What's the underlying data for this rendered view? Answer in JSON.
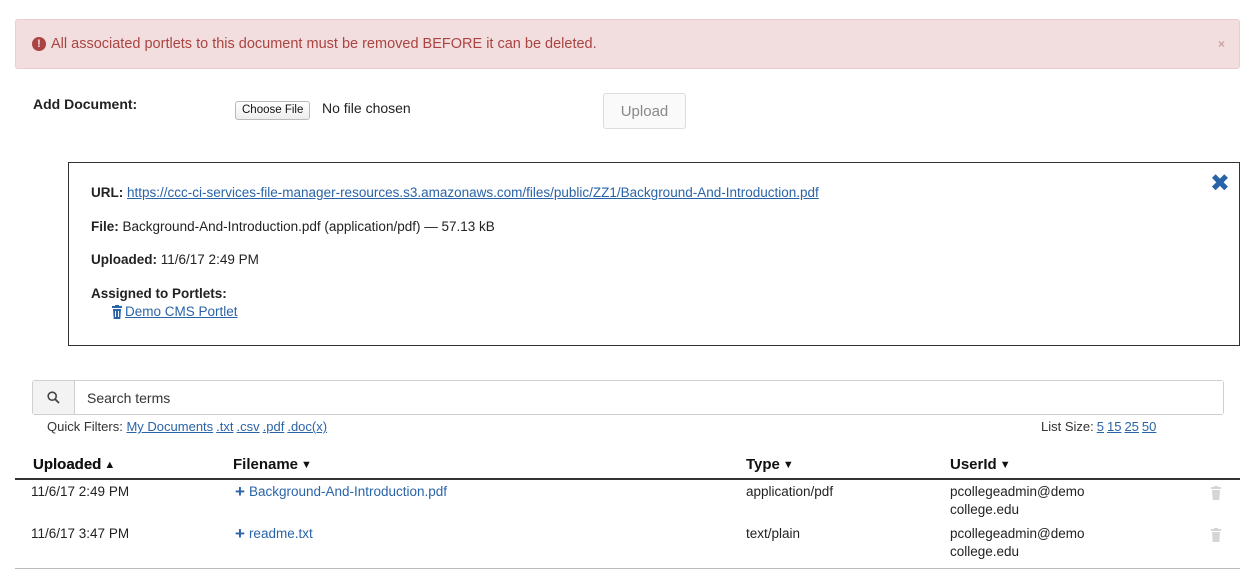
{
  "alert": {
    "message": "All associated portlets to this document must be removed BEFORE it can be deleted.",
    "close": "×"
  },
  "upload": {
    "label": "Add Document:",
    "choose_button": "Choose File",
    "no_file": "No file chosen",
    "upload_button": "Upload"
  },
  "detail": {
    "url_label": "URL:",
    "url": "https://ccc-ci-services-file-manager-resources.s3.amazonaws.com/files/public/ZZ1/Background-And-Introduction.pdf",
    "file_label": "File:",
    "file_value": "Background-And-Introduction.pdf (application/pdf) — 57.13 kB",
    "uploaded_label": "Uploaded:",
    "uploaded_value": "11/6/17 2:49 PM",
    "assigned_label": "Assigned to Portlets:",
    "portlets": [
      "Demo CMS Portlet"
    ]
  },
  "search": {
    "placeholder": "Search terms"
  },
  "filters": {
    "label": "Quick Filters:",
    "items": [
      "My Documents",
      ".txt",
      ".csv",
      ".pdf",
      ".doc(x)"
    ]
  },
  "list_size": {
    "label": "List Size:",
    "options": [
      "5",
      "15",
      "25",
      "50"
    ]
  },
  "table": {
    "columns": [
      "Uploaded",
      "Filename",
      "Type",
      "UserId"
    ],
    "rows": [
      {
        "uploaded": "11/6/17 2:49 PM",
        "filename": "Background-And-Introduction.pdf",
        "type": "application/pdf",
        "user_line1": "pcollegeadmin@demo",
        "user_line2": "college.edu"
      },
      {
        "uploaded": "11/6/17 3:47 PM",
        "filename": "readme.txt",
        "type": "text/plain",
        "user_line1": "pcollegeadmin@demo",
        "user_line2": "college.edu"
      }
    ]
  },
  "colors": {
    "link": "#2a64a8",
    "alert_bg": "#f2dede",
    "alert_text": "#a94442"
  }
}
